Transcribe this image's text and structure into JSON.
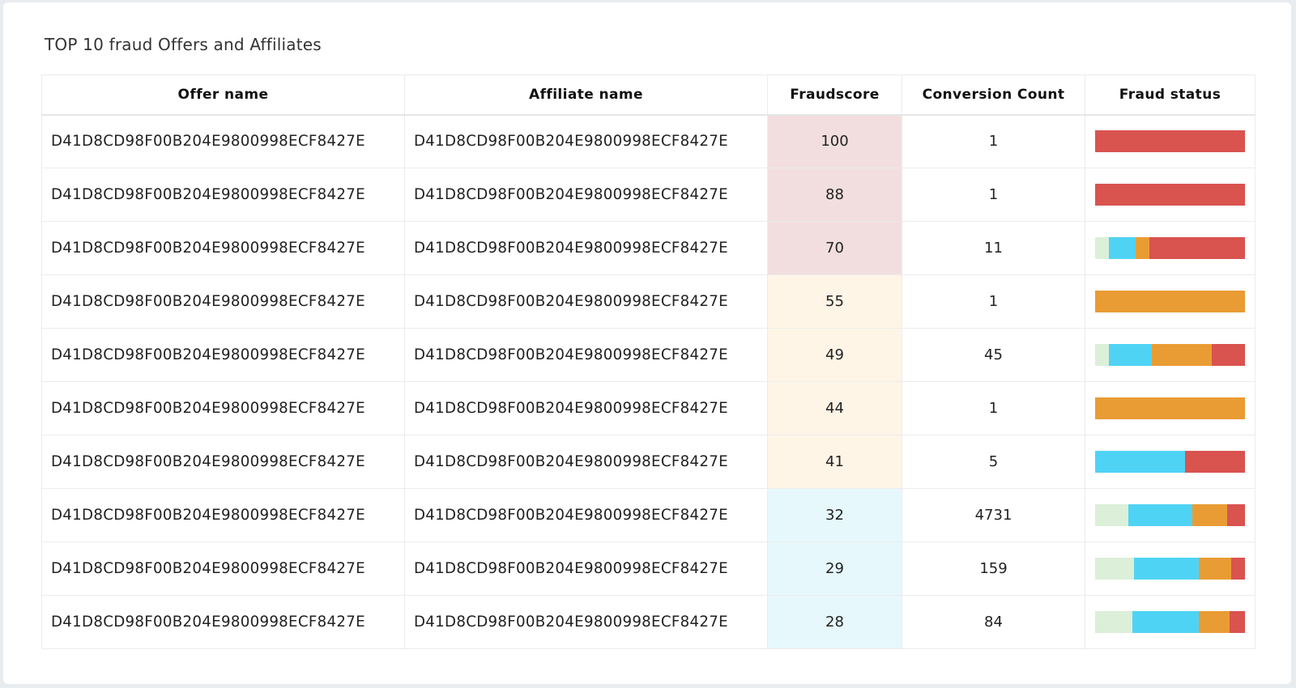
{
  "widget": {
    "title": "TOP 10 fraud Offers and Affiliates"
  },
  "table": {
    "headers": {
      "offer": "Offer name",
      "affiliate": "Affiliate name",
      "fraudscore": "Fraudscore",
      "conversions": "Conversion Count",
      "status": "Fraud status"
    },
    "score_colors": {
      "high": "#f2dede",
      "medium": "#fef5e7",
      "low": "#e6f8fc"
    },
    "status_colors": [
      "#dcefd9",
      "#4fd3f5",
      "#e99c34",
      "#d9534f"
    ],
    "rows": [
      {
        "offer": "D41D8CD98F00B204E9800998ECF8427E",
        "affiliate": "D41D8CD98F00B204E9800998ECF8427E",
        "fraudscore": "100",
        "conversions": "1",
        "level": "high",
        "status": [
          0,
          0,
          0,
          1
        ]
      },
      {
        "offer": "D41D8CD98F00B204E9800998ECF8427E",
        "affiliate": "D41D8CD98F00B204E9800998ECF8427E",
        "fraudscore": "88",
        "conversions": "1",
        "level": "high",
        "status": [
          0,
          0,
          0,
          1
        ]
      },
      {
        "offer": "D41D8CD98F00B204E9800998ECF8427E",
        "affiliate": "D41D8CD98F00B204E9800998ECF8427E",
        "fraudscore": "70",
        "conversions": "11",
        "level": "high",
        "status": [
          0.09,
          0.18,
          0.09,
          0.64
        ]
      },
      {
        "offer": "D41D8CD98F00B204E9800998ECF8427E",
        "affiliate": "D41D8CD98F00B204E9800998ECF8427E",
        "fraudscore": "55",
        "conversions": "1",
        "level": "medium",
        "status": [
          0,
          0,
          1,
          0
        ]
      },
      {
        "offer": "D41D8CD98F00B204E9800998ECF8427E",
        "affiliate": "D41D8CD98F00B204E9800998ECF8427E",
        "fraudscore": "49",
        "conversions": "45",
        "level": "medium",
        "status": [
          0.09,
          0.29,
          0.4,
          0.22
        ]
      },
      {
        "offer": "D41D8CD98F00B204E9800998ECF8427E",
        "affiliate": "D41D8CD98F00B204E9800998ECF8427E",
        "fraudscore": "44",
        "conversions": "1",
        "level": "medium",
        "status": [
          0,
          0,
          1,
          0
        ]
      },
      {
        "offer": "D41D8CD98F00B204E9800998ECF8427E",
        "affiliate": "D41D8CD98F00B204E9800998ECF8427E",
        "fraudscore": "41",
        "conversions": "5",
        "level": "medium",
        "status": [
          0,
          0.6,
          0,
          0.4
        ]
      },
      {
        "offer": "D41D8CD98F00B204E9800998ECF8427E",
        "affiliate": "D41D8CD98F00B204E9800998ECF8427E",
        "fraudscore": "32",
        "conversions": "4731",
        "level": "low",
        "status": [
          0.22,
          0.43,
          0.23,
          0.12
        ]
      },
      {
        "offer": "D41D8CD98F00B204E9800998ECF8427E",
        "affiliate": "D41D8CD98F00B204E9800998ECF8427E",
        "fraudscore": "29",
        "conversions": "159",
        "level": "low",
        "status": [
          0.26,
          0.43,
          0.22,
          0.09
        ]
      },
      {
        "offer": "D41D8CD98F00B204E9800998ECF8427E",
        "affiliate": "D41D8CD98F00B204E9800998ECF8427E",
        "fraudscore": "28",
        "conversions": "84",
        "level": "low",
        "status": [
          0.25,
          0.44,
          0.21,
          0.1
        ]
      }
    ]
  }
}
